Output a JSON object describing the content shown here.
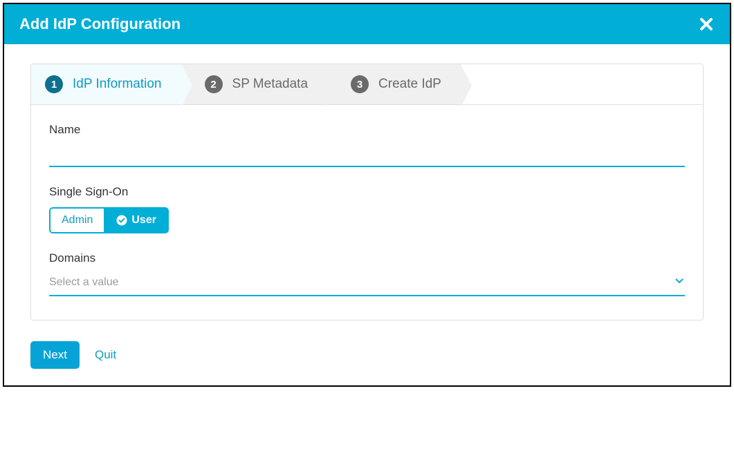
{
  "modal": {
    "title": "Add IdP Configuration"
  },
  "wizard": {
    "steps": [
      {
        "num": "1",
        "label": "IdP Information"
      },
      {
        "num": "2",
        "label": "SP Metadata"
      },
      {
        "num": "3",
        "label": "Create IdP"
      }
    ]
  },
  "form": {
    "name_label": "Name",
    "name_value": "",
    "sso_label": "Single Sign-On",
    "sso_options": {
      "admin": "Admin",
      "user": "User"
    },
    "domains_label": "Domains",
    "domains_placeholder": "Select a value"
  },
  "footer": {
    "next": "Next",
    "quit": "Quit"
  }
}
